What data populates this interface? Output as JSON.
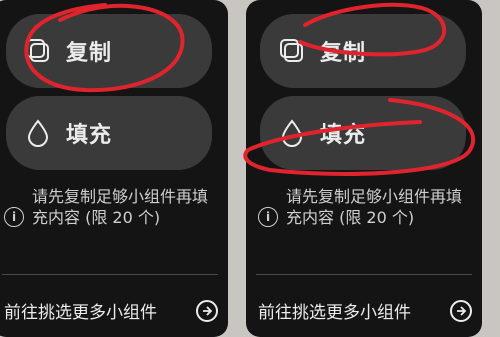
{
  "panels": [
    {
      "copy_label": "复制",
      "fill_label": "填充",
      "note": "请先复制足够小组件再填充内容 (限 20 个)",
      "more_label": "前往挑选更多小组件"
    },
    {
      "copy_label": "复制",
      "fill_label": "填充",
      "note": "请先复制足够小组件再填充内容 (限 20 个)",
      "more_label": "前往挑选更多小组件"
    }
  ],
  "colors": {
    "panel_bg": "#141414",
    "button_bg": "#3a3a3a",
    "text": "#ececec",
    "annotation": "#e0242d"
  },
  "icons": [
    "copy-icon",
    "water-drop-icon",
    "info-icon",
    "arrow-right-circle-icon"
  ]
}
